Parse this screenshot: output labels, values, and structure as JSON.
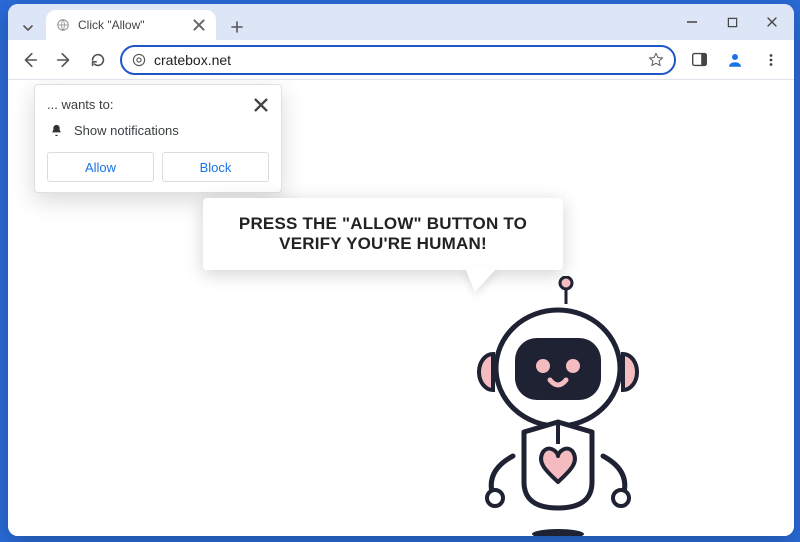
{
  "tab": {
    "title": "Click \"Allow\""
  },
  "omnibox": {
    "url": "cratebox.net"
  },
  "permission": {
    "wants_to": "... wants to:",
    "show_notifications": "Show notifications",
    "allow": "Allow",
    "block": "Block"
  },
  "speech": {
    "text": "PRESS THE \"ALLOW\" BUTTON TO VERIFY YOU'RE HUMAN!"
  }
}
